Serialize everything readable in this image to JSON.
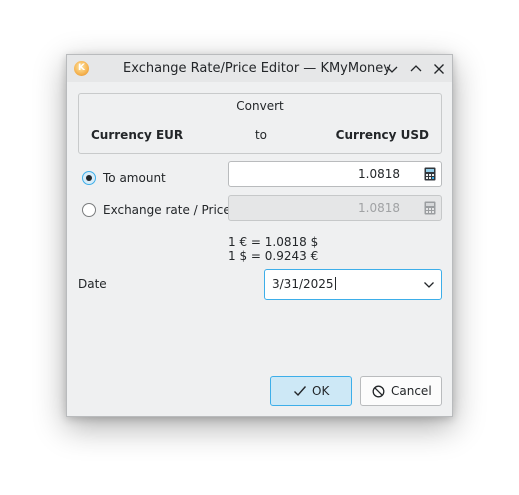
{
  "window": {
    "title": "Exchange Rate/Price Editor — KMyMoney",
    "icon": "kmymoney-app-icon"
  },
  "convert": {
    "title": "Convert",
    "from": "Currency EUR",
    "to_label": "to",
    "to": "Currency USD"
  },
  "to_amount": {
    "label": "To amount",
    "value": "1.0818",
    "checked": true
  },
  "exchange_rate": {
    "label": "Exchange rate / Price",
    "value": "1.0818",
    "checked": false
  },
  "rates": {
    "line1": "1 € = 1.0818 $",
    "line2": "1 $ = 0.9243 €"
  },
  "date": {
    "label": "Date",
    "value": "3/31/2025"
  },
  "buttons": {
    "ok": "OK",
    "cancel": "Cancel"
  },
  "colors": {
    "focus": "#3daee9",
    "ok_fill": "#cde8f6",
    "window_bg": "#eff0f1"
  }
}
